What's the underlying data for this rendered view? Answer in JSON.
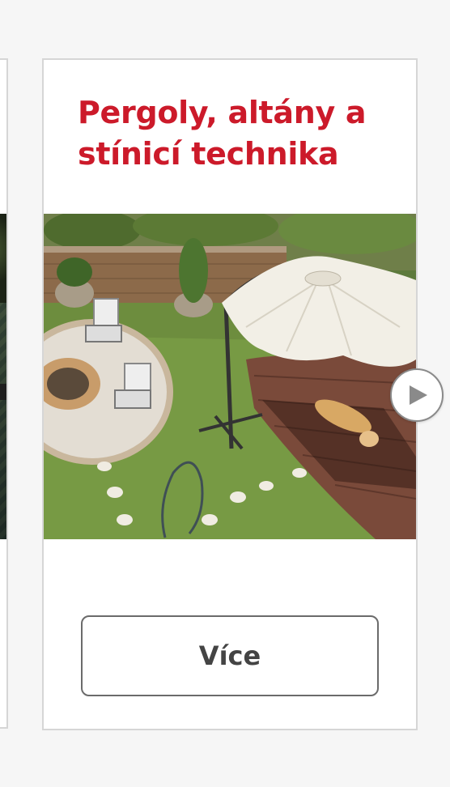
{
  "carousel": {
    "current_card": {
      "title": "Pergoly, altány a stínicí technika",
      "image_icon": "garden-umbrella-photo",
      "button_label": "Více"
    },
    "next_button_icon": "play-triangle-icon"
  },
  "colors": {
    "title": "#cc1a2a",
    "button_border": "#6b6b6b",
    "button_text": "#444444",
    "card_border": "#d6d6d6"
  }
}
